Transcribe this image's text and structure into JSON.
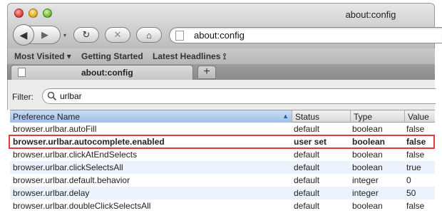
{
  "window": {
    "title": "about:config"
  },
  "toolbar": {
    "back_glyph": "◀",
    "forward_glyph": "▶",
    "dropdown_glyph": "▾",
    "reload_glyph": "↻",
    "stop_glyph": "✕",
    "home_glyph": "⌂",
    "url": "about:config"
  },
  "bookmarks": [
    {
      "label": "Most Visited ▾"
    },
    {
      "label": "Getting Started"
    },
    {
      "label": "Latest Headlines ⟟"
    }
  ],
  "tabs": {
    "active_title": "about:config",
    "new_tab_label": "+"
  },
  "filter": {
    "label": "Filter:",
    "value": "urlbar"
  },
  "table": {
    "headers": {
      "preference": "Preference Name",
      "status": "Status",
      "type": "Type",
      "value": "Value",
      "sort_indicator": "▲"
    },
    "rows": [
      {
        "name": "browser.urlbar.autoFill",
        "status": "default",
        "type": "boolean",
        "value": "false"
      },
      {
        "name": "browser.urlbar.autocomplete.enabled",
        "status": "user set",
        "type": "boolean",
        "value": "false",
        "modified": true,
        "highlighted": true
      },
      {
        "name": "browser.urlbar.clickAtEndSelects",
        "status": "default",
        "type": "boolean",
        "value": "false"
      },
      {
        "name": "browser.urlbar.clickSelectsAll",
        "status": "default",
        "type": "boolean",
        "value": "true"
      },
      {
        "name": "browser.urlbar.default.behavior",
        "status": "default",
        "type": "integer",
        "value": "0"
      },
      {
        "name": "browser.urlbar.delay",
        "status": "default",
        "type": "integer",
        "value": "50"
      },
      {
        "name": "browser.urlbar.doubleClickSelectsAll",
        "status": "default",
        "type": "boolean",
        "value": "false"
      }
    ]
  },
  "colors": {
    "highlight_border": "#e03a3a",
    "alt_row": "#edf3fe",
    "sorted_header": "#b6cff0"
  }
}
